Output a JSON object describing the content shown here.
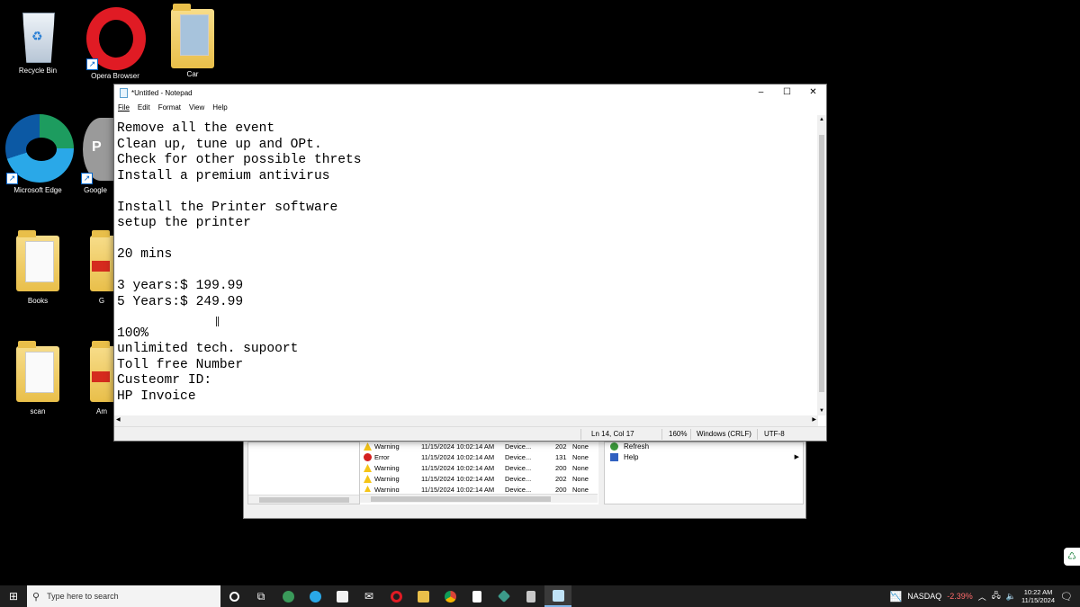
{
  "desktop": {
    "icons": [
      {
        "label": "Recycle Bin"
      },
      {
        "label": "Opera Browser"
      },
      {
        "label": "Car"
      },
      {
        "label": "Microsoft Edge"
      },
      {
        "label": "Google"
      },
      {
        "label": "Books"
      },
      {
        "label": "G"
      },
      {
        "label": "scan"
      },
      {
        "label": "Am"
      }
    ]
  },
  "event_viewer": {
    "rows": [
      {
        "level": "Warning",
        "date": "11/15/2024 10:02:14 AM",
        "source": "Device...",
        "id": "202",
        "task": "None"
      },
      {
        "level": "Error",
        "date": "11/15/2024 10:02:14 AM",
        "source": "Device...",
        "id": "131",
        "task": "None"
      },
      {
        "level": "Warning",
        "date": "11/15/2024 10:02:14 AM",
        "source": "Device...",
        "id": "200",
        "task": "None"
      },
      {
        "level": "Warning",
        "date": "11/15/2024 10:02:14 AM",
        "source": "Device...",
        "id": "202",
        "task": "None"
      },
      {
        "level": "Warning",
        "date": "11/15/2024 10:02:14 AM",
        "source": "Device...",
        "id": "200",
        "task": "None"
      }
    ],
    "actions": {
      "refresh": "Refresh",
      "help": "Help"
    }
  },
  "notepad": {
    "title": "*Untitled - Notepad",
    "menu": {
      "file": "File",
      "edit": "Edit",
      "format": "Format",
      "view": "View",
      "help": "Help"
    },
    "content": "Remove all the event\nClean up, tune up and OPt.\nCheck for other possible threts\nInstall a premium antivirus\n\nInstall the Printer software\nsetup the printer\n\n20 mins\n\n3 years:$ 199.99\n5 Years:$ 249.99\n\n100%\nunlimited tech. supoort\nToll free Number\nCusteomr ID:\nHP Invoice",
    "status": {
      "position": "Ln 14, Col 17",
      "zoom": "160%",
      "line_ending": "Windows (CRLF)",
      "encoding": "UTF-8"
    }
  },
  "taskbar": {
    "search_placeholder": "Type here to search",
    "ticker_name": "NASDAQ",
    "ticker_change": "-2.39%",
    "time": "10:22 AM",
    "date": "11/15/2024"
  }
}
